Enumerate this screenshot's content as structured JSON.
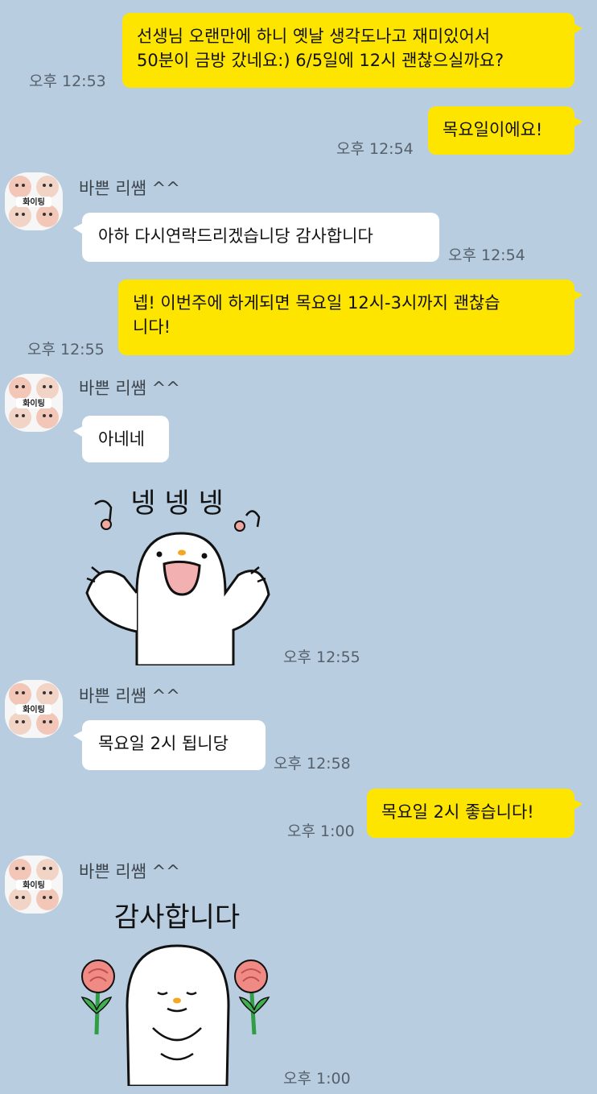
{
  "sender_name": "바쁜 리쌤  ^^",
  "avatar_badge": "화이팅",
  "messages": {
    "m1": {
      "line1": "선생님 오랜만에 하니 옛날 생각도나고 재미있어서",
      "line2": "50분이 금방 갔네요:) 6/5일에 12시 괜찮으실까요?",
      "time": "오후 12:53"
    },
    "m2": {
      "text": "목요일이에요!",
      "time": "오후 12:54"
    },
    "m3": {
      "text": "아하 다시연락드리겠습니당 감사합니다",
      "time": "오후 12:54"
    },
    "m4": {
      "line1": "넵! 이번주에 하게되면 목요일 12시-3시까지 괜찮습",
      "line2": "니다!",
      "time": "오후 12:55"
    },
    "m5": {
      "text": "아네네"
    },
    "m6": {
      "sticker_text": "넹 넹 넹",
      "time": "오후 12:55"
    },
    "m7": {
      "text": "목요일 2시 됩니당",
      "time": "오후 12:58"
    },
    "m8": {
      "text": "목요일 2시 좋습니다!",
      "time": "오후 1:00"
    },
    "m9": {
      "sticker_text": "감사합니다",
      "time": "오후 1:00"
    }
  },
  "colors": {
    "background": "#b9cde0",
    "outgoing_bubble": "#fee500",
    "incoming_bubble": "#ffffff"
  }
}
